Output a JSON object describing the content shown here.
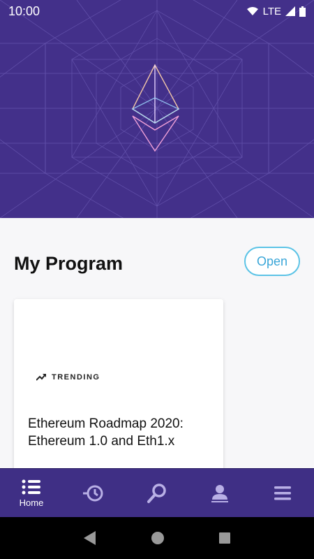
{
  "status_bar": {
    "time": "10:00",
    "network": "LTE"
  },
  "section": {
    "title": "My Program",
    "open_button": "Open"
  },
  "card": {
    "badge": "TRENDING",
    "title": "Ethereum Roadmap 2020: Ethereum 1.0 and Eth1.x"
  },
  "bottom_nav": {
    "items": [
      {
        "label": "Home",
        "icon": "list-icon",
        "active": true
      },
      {
        "label": "",
        "icon": "history-icon",
        "active": false
      },
      {
        "label": "",
        "icon": "search-icon",
        "active": false
      },
      {
        "label": "",
        "icon": "profile-icon",
        "active": false
      },
      {
        "label": "",
        "icon": "menu-icon",
        "active": false
      }
    ]
  },
  "colors": {
    "hero_bg": "#43308a",
    "nav_bg": "#3f2f85",
    "accent": "#5bc3e6",
    "nav_inactive": "#b9b0e6"
  }
}
